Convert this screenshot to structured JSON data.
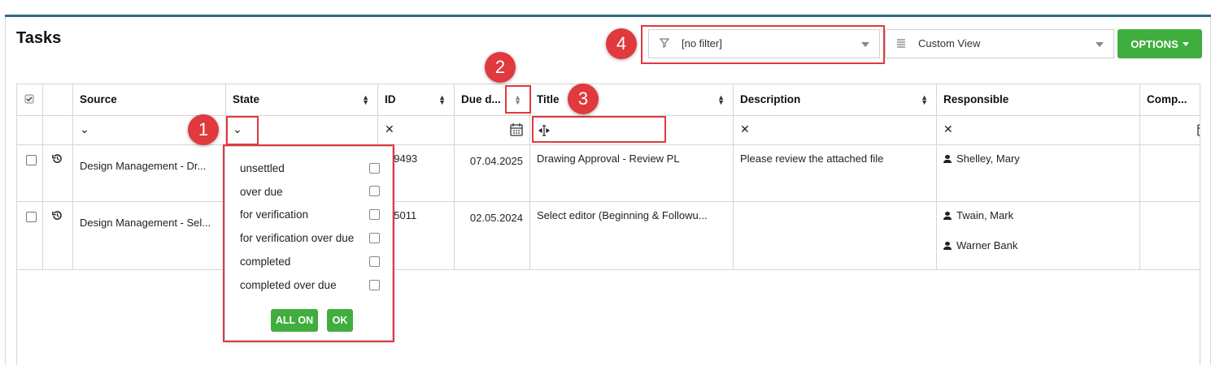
{
  "page": {
    "title": "Tasks"
  },
  "toolbar": {
    "filter_value": "[no filter]",
    "view_value": "Custom View",
    "options_label": "OPTIONS"
  },
  "icons": {
    "filter": "funnel-icon",
    "view": "list-icon",
    "history": "history-icon",
    "calendar": "calendar-icon",
    "person": "person-icon"
  },
  "table": {
    "headers": {
      "source": "Source",
      "state": "State",
      "id": "ID",
      "due": "Due d...",
      "title": "Title",
      "description": "Description",
      "responsible": "Responsible",
      "comp": "Comp..."
    },
    "filter_row": {
      "chevron": "⌄",
      "clear": "✕"
    },
    "rows": [
      {
        "source": "Design Management - Dr...",
        "id": "89493",
        "due": "07.04.2025",
        "title": "Drawing Approval - Review PL",
        "description": "Please review the attached file",
        "responsible": [
          "Shelley, Mary"
        ]
      },
      {
        "source": "Design Management - Sel...",
        "id": "15011",
        "due": "02.05.2024",
        "title": "Select editor (Beginning & Followu...",
        "description": "",
        "responsible": [
          "Twain, Mark",
          "Warner Bank"
        ]
      }
    ]
  },
  "state_dropdown": {
    "options": [
      "unsettled",
      "over due",
      "for verification",
      "for verification over due",
      "completed",
      "completed over due"
    ],
    "all_on_label": "ALL ON",
    "ok_label": "OK"
  },
  "annotations": [
    "1",
    "2",
    "3",
    "4"
  ],
  "colors": {
    "accent_green": "#3fae3f",
    "annotation_red": "#e0393e",
    "top_bar": "#2e6b85"
  }
}
